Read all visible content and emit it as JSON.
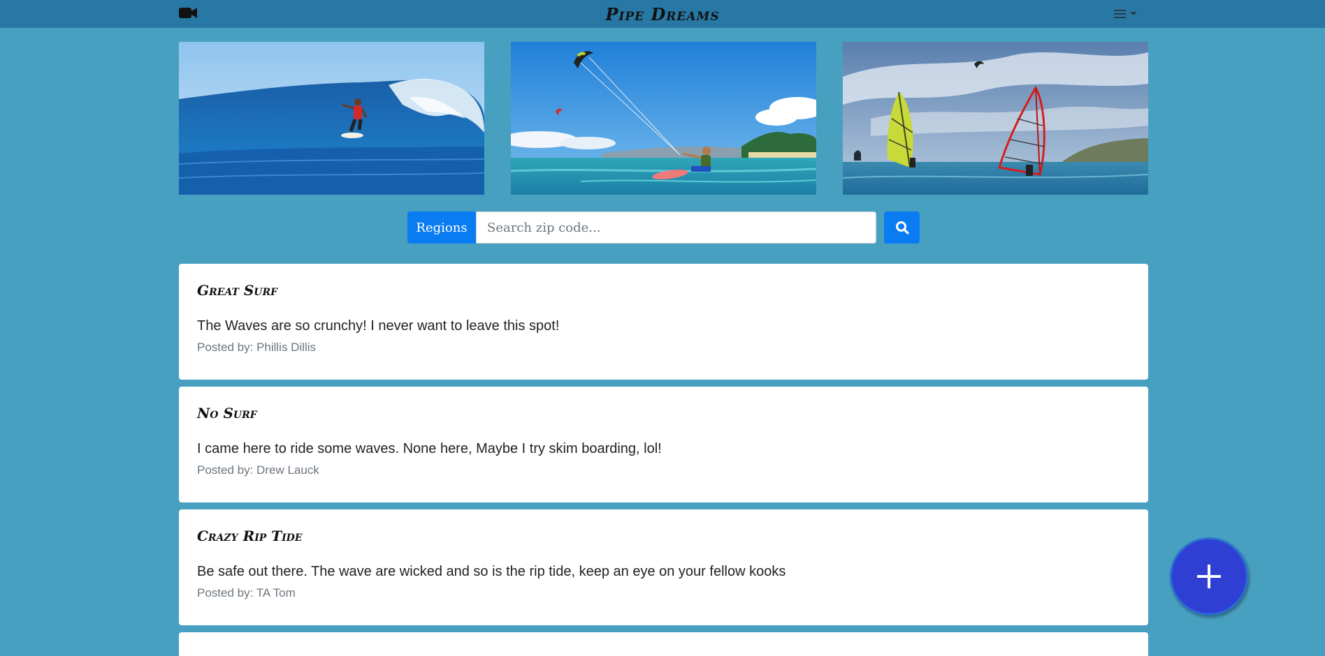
{
  "app": {
    "title": "Pipe Dreams"
  },
  "nav": {
    "left_icon": "video-camera-icon",
    "menu_icon": "hamburger-menu-icon"
  },
  "hero_images": [
    {
      "subject": "surfer riding a large blue wave"
    },
    {
      "subject": "kitesurfer on turquoise water with kites in the sky"
    },
    {
      "subject": "two windsurfers with yellow and red sails"
    }
  ],
  "search": {
    "regions_label": "Regions",
    "placeholder": "Search zip code...",
    "value": "",
    "icon": "search-icon"
  },
  "posts": [
    {
      "title": "Great Surf",
      "body": "The Waves are so crunchy! I never want to leave this spot!",
      "author": "Posted by: Phillis Dillis"
    },
    {
      "title": "No Surf",
      "body": "I came here to ride some waves. None here, Maybe I try skim boarding, lol!",
      "author": "Posted by: Drew Lauck"
    },
    {
      "title": "Crazy Rip Tide",
      "body": "Be safe out there. The wave are wicked and so is the rip tide, keep an eye on your fellow kooks",
      "author": "Posted by: TA Tom"
    },
    {
      "title": "",
      "body": "",
      "author": ""
    }
  ],
  "fab": {
    "icon": "plus-icon"
  },
  "colors": {
    "page_bg": "#48a0c1",
    "nav_bg": "#2878a6",
    "primary_button": "#0a7cf2",
    "fab": "#2f3fd4"
  }
}
